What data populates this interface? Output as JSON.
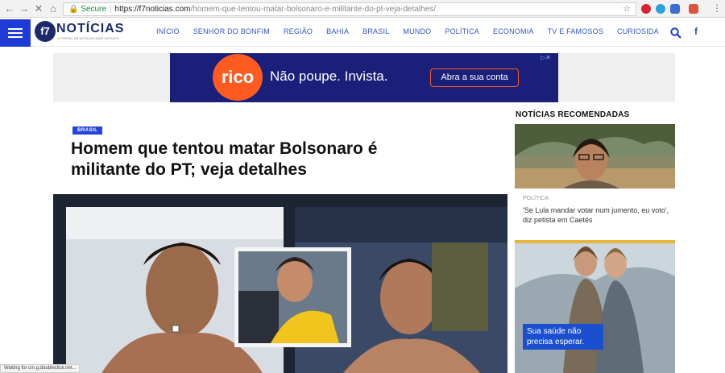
{
  "browser": {
    "secure_label": "Secure",
    "url_host": "https://f7noticias.com",
    "url_path": "/homem-que-tentou-matar-bolsonaro-e-militante-do-pt-veja-detalhes/"
  },
  "site": {
    "logo_mark": "f7",
    "logo_text": "NOTÍCIAS",
    "logo_sub": "O PORTAL DE NOTÍCIAS MAIS VISITADO",
    "menu": [
      "INÍCIO",
      "SENHOR DO BONFIM",
      "REGIÃO",
      "BAHIA",
      "BRASIL",
      "MUNDO",
      "POLÍTICA",
      "ECONOMIA",
      "TV E FAMOSOS",
      "CURIOSIDA"
    ]
  },
  "ad": {
    "brand": "rico",
    "text": "Não poupe. Invista.",
    "button": "Abra a sua conta",
    "close": "▷✕"
  },
  "article": {
    "category": "BRASIL",
    "headline": "Homem que tentou matar Bolsonaro é militante do PT; veja detalhes"
  },
  "sidebar": {
    "title": "NOTÍCIAS RECOMENDADAS",
    "item_category": "POLÍTICA",
    "item_text": "'Se Lula mandar votar num jumento, eu voto', diz petista em Caetés",
    "ad_text": "Sua saúde não precisa esperar."
  },
  "status": "Waiting for cm.g.doubleclick.net...",
  "colors": {
    "brand_blue": "#1f3bd6",
    "menu_link": "#3056c8",
    "ad_bg": "#1a1f7a",
    "ad_accent": "#ff5a1f"
  }
}
